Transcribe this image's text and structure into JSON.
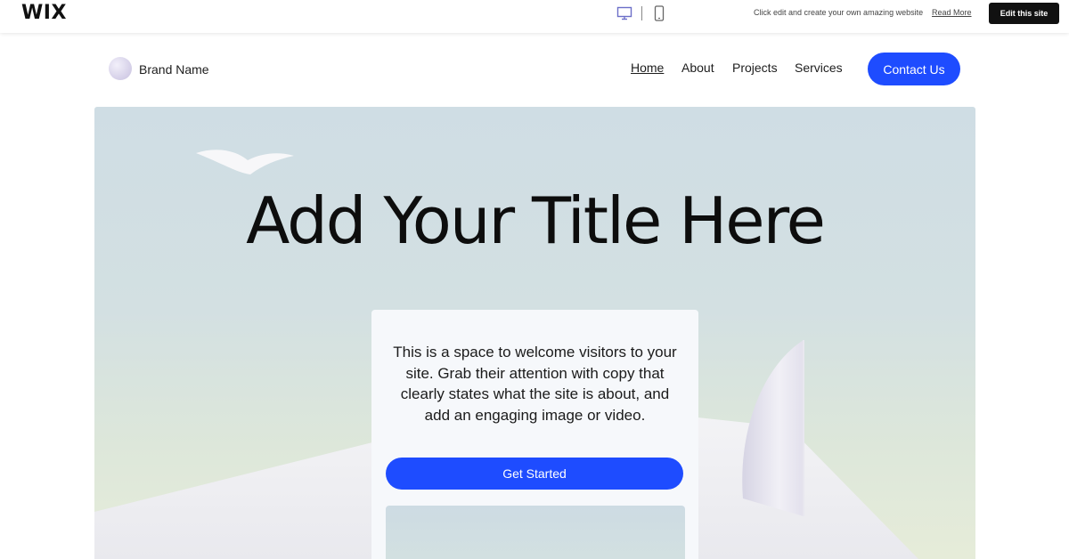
{
  "wix_bar": {
    "logo": "WIX",
    "desktop_icon": "desktop-monitor-icon",
    "mobile_icon": "mobile-phone-icon",
    "message": "Click edit and create your own amazing website",
    "read_more": "Read More",
    "edit_button": "Edit this site"
  },
  "header": {
    "brand_name": "Brand Name",
    "nav": [
      "Home",
      "About",
      "Projects",
      "Services"
    ],
    "active_nav": "Home",
    "contact_button": "Contact Us"
  },
  "hero": {
    "title": "Add Your Title Here",
    "card": {
      "text": "This is a space to welcome visitors to your site. Grab their attention with copy that clearly states what the site is about, and add an engaging image or video.",
      "button": "Get Started"
    }
  },
  "colors": {
    "accent": "#1e4cff",
    "edit_button_bg": "#111111",
    "hero_sky": "#cfdde4"
  }
}
